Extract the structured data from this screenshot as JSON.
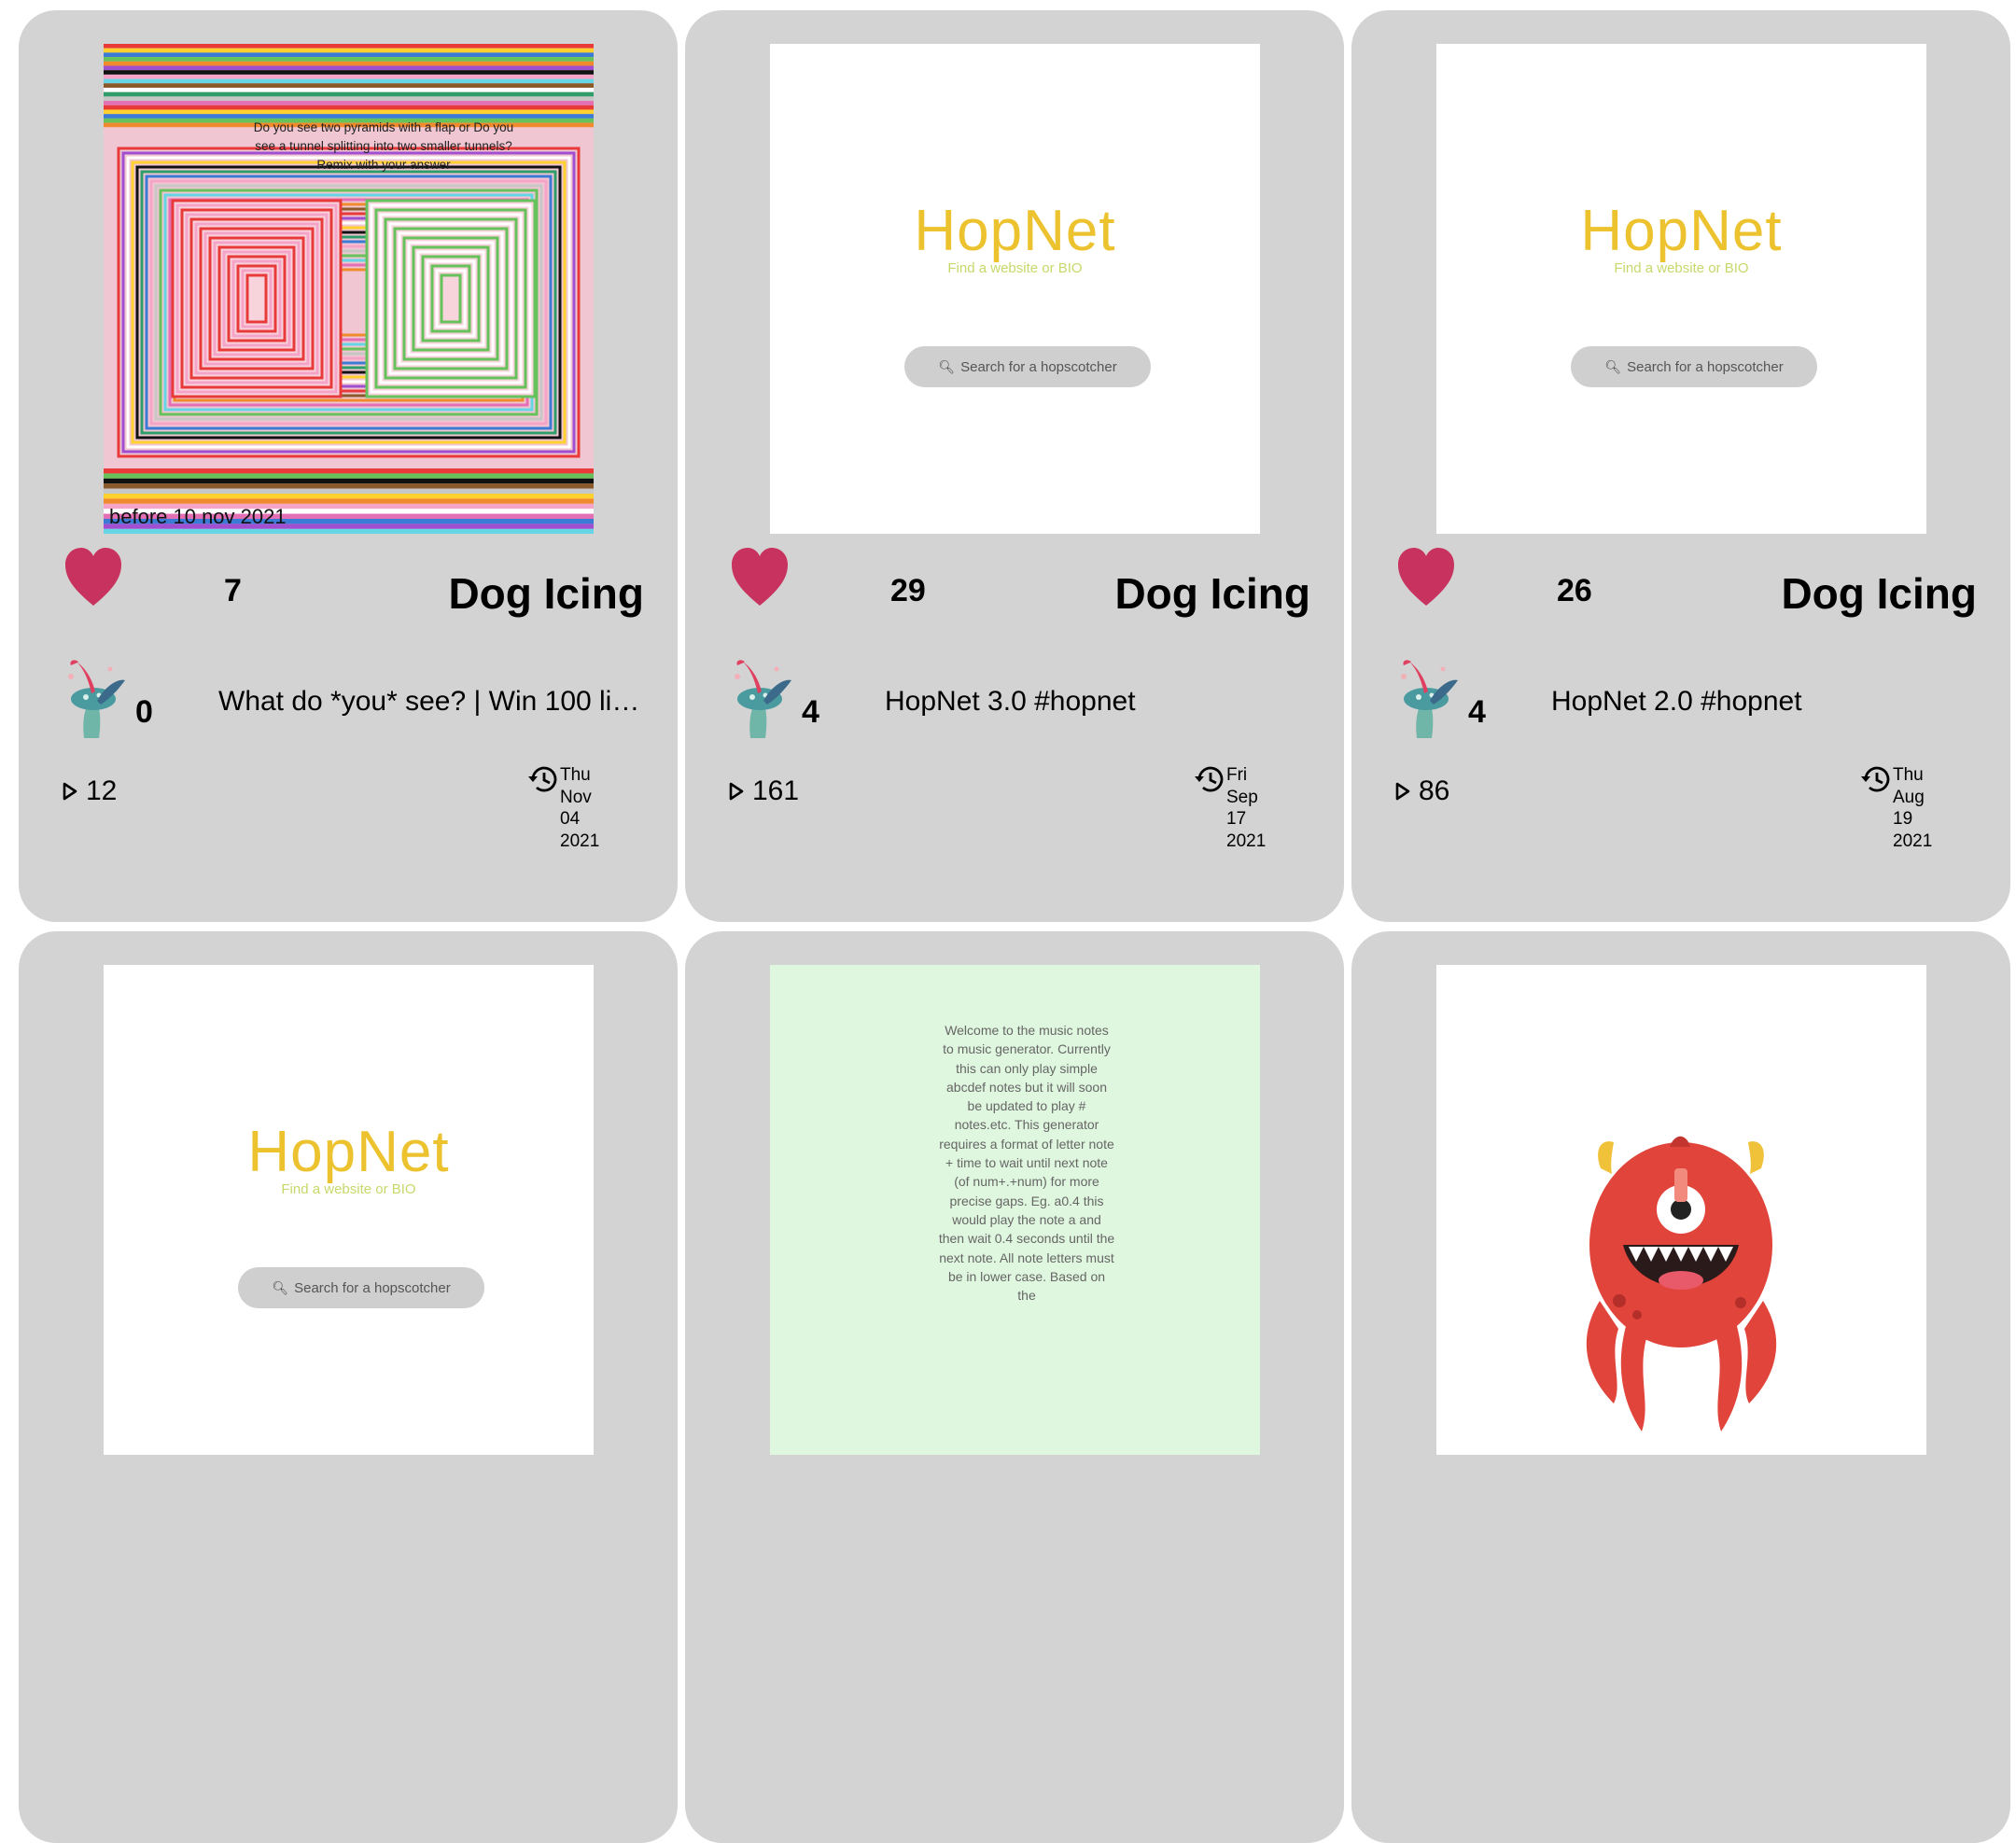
{
  "colors": {
    "card_bg": "#d3d3d3",
    "heart": "#c8325e",
    "hopnet_title": "#ecc22e",
    "hopnet_sub": "#c8d86a",
    "music_bg": "#dff6df"
  },
  "icons": {
    "like": "heart-icon",
    "avatar": "mushroom-avatar-icon",
    "plays": "play-triangle-icon",
    "date": "history-clock-icon"
  },
  "cards": [
    {
      "likes": "7",
      "author": "Dog Icing",
      "remixes": "0",
      "title": "What do *you* see? | Win 100 lik…",
      "plays": "12",
      "date": [
        "Thu",
        "Nov",
        "04",
        "2021"
      ],
      "thumb": {
        "kind": "illusion",
        "text": "Do you see two pyramids with a flap or Do you see a tunnel splitting into two smaller tunnels? Remix with your answer",
        "footer": "before 10 nov 2021"
      }
    },
    {
      "likes": "29",
      "author": "Dog Icing",
      "remixes": "4",
      "title": "HopNet 3.0 #hopnet",
      "plays": "161",
      "date": [
        "Fri",
        "Sep",
        "17",
        "2021"
      ],
      "thumb": {
        "kind": "hopnet",
        "brand": "HopNet",
        "sub": "Find a website or BIO",
        "search": "Search for a hopscotcher"
      }
    },
    {
      "likes": "26",
      "author": "Dog Icing",
      "remixes": "4",
      "title": "HopNet 2.0 #hopnet",
      "plays": "86",
      "date": [
        "Thu",
        "Aug",
        "19",
        "2021"
      ],
      "thumb": {
        "kind": "hopnet",
        "brand": "HopNet",
        "sub": "Find a website or BIO",
        "search": "Search for a hopscotcher"
      }
    },
    {
      "thumb": {
        "kind": "hopnet",
        "brand": "HopNet",
        "sub": "Find a website or BIO",
        "search": "Search for a hopscotcher"
      }
    },
    {
      "thumb": {
        "kind": "music",
        "text": "Welcome to the music notes to music generator. Currently this can only play simple abcdef notes but it will soon be updated to play # notes.etc. This generator requires a format of letter note + time to wait until next note (of num+.+num) for more precise gaps. Eg. a0.4 this would play the note a and then wait 0.4 seconds until the next note. All note letters must be in lower case. Based on the"
      }
    },
    {
      "thumb": {
        "kind": "monster"
      }
    }
  ]
}
